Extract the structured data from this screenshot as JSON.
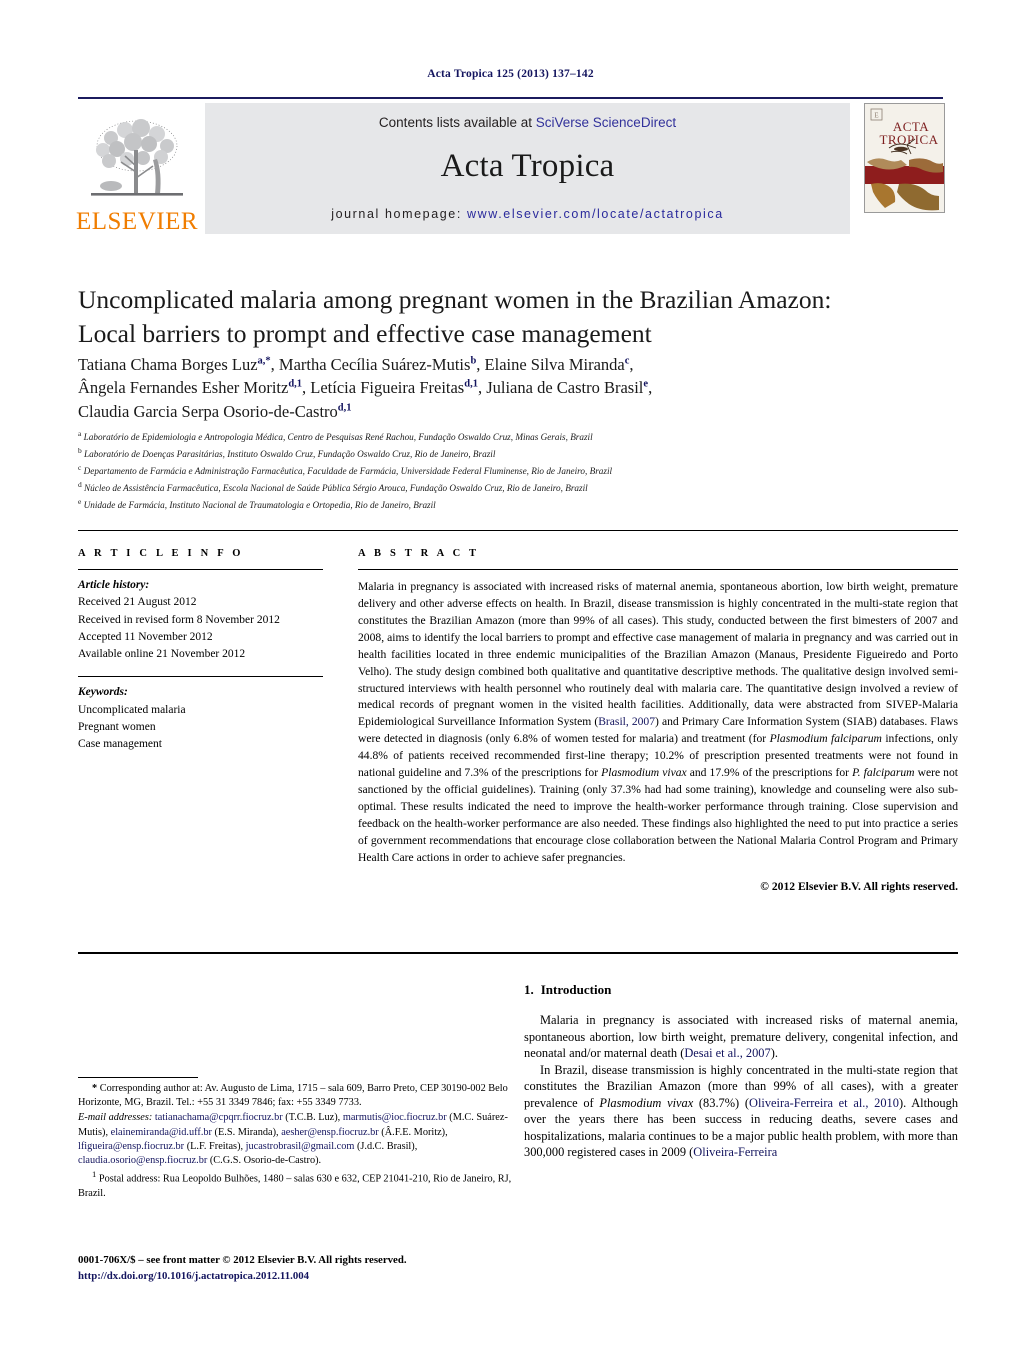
{
  "running_head": "Acta Tropica 125 (2013) 137–142",
  "header": {
    "contents_prefix": "Contents lists available at ",
    "contents_link": "SciVerse ScienceDirect",
    "journal_title": "Acta Tropica",
    "homepage_label": "journal homepage:",
    "homepage_url": "www.elsevier.com/locate/actatropica",
    "publisher_logo_text": "ELSEVIER",
    "cover_title_line1": "ACTA",
    "cover_title_line2": "TROPICA",
    "accent_orange": "#f07d00",
    "accent_navy": "#13145e",
    "link_blue": "#32329b",
    "banner_bg": "#e6e7e9"
  },
  "article": {
    "title_line1": "Uncomplicated malaria among pregnant women in the Brazilian Amazon:",
    "title_line2": "Local barriers to prompt and effective case management",
    "authors_line1": "Tatiana Chama Borges Luz<sup>a,*</sup>, Martha Cecília Suárez-Mutis<sup>b</sup>, Elaine Silva Miranda<sup>c</sup>,",
    "authors_line2": "Ângela Fernandes Esher Moritz<sup>d,1</sup>, Letícia Figueira Freitas<sup>d,1</sup>, Juliana de Castro Brasil<sup>e</sup>,",
    "authors_line3": "Claudia Garcia Serpa Osorio-de-Castro<sup>d,1</sup>",
    "affiliations": [
      {
        "mark": "a",
        "text": "Laboratório de Epidemiologia e Antropologia Médica, Centro de Pesquisas René Rachou, Fundação Oswaldo Cruz, Minas Gerais, Brazil"
      },
      {
        "mark": "b",
        "text": "Laboratório de Doenças Parasitárias, Instituto Oswaldo Cruz, Fundação Oswaldo Cruz, Rio de Janeiro, Brazil"
      },
      {
        "mark": "c",
        "text": "Departamento de Farmácia e Administração Farmacêutica, Faculdade de Farmácia, Universidade Federal Fluminense, Rio de Janeiro, Brazil"
      },
      {
        "mark": "d",
        "text": "Núcleo de Assistência Farmacêutica, Escola Nacional de Saúde Pública Sérgio Arouca, Fundação Oswaldo Cruz, Rio de Janeiro, Brazil"
      },
      {
        "mark": "e",
        "text": "Unidade de Farmácia, Instituto Nacional de Traumatologia e Ortopedia, Rio de Janeiro, Brazil"
      }
    ]
  },
  "article_info": {
    "heading": "A R T I C L E   I N F O",
    "history_label": "Article history:",
    "history": [
      "Received 21 August 2012",
      "Received in revised form 8 November 2012",
      "Accepted 11 November 2012",
      "Available online 21 November 2012"
    ],
    "keywords_label": "Keywords:",
    "keywords": [
      "Uncomplicated malaria",
      "Pregnant women",
      "Case management"
    ]
  },
  "abstract": {
    "heading": "A B S T R A C T",
    "html": "Malaria in pregnancy is associated with increased risks of maternal anemia, spontaneous abortion, low birth weight, premature delivery and other adverse effects on health. In Brazil, disease transmission is highly concentrated in the multi-state region that constitutes the Brazilian Amazon (more than 99% of all cases). This study, conducted between the first bimesters of 2007 and 2008, aims to identify the local barriers to prompt and effective case management of malaria in pregnancy and was carried out in health facilities located in three endemic municipalities of the Brazilian Amazon (Manaus, Presidente Figueiredo and Porto Velho). The study design combined both qualitative and quantitative descriptive methods. The qualitative design involved semi-structured interviews with health personnel who routinely deal with malaria care. The quantitative design involved a review of medical records of pregnant women in the visited health facilities. Additionally, data were abstracted from SIVEP-Malaria Epidemiological Surveillance Information System (<a href=\"#\">Brasil, 2007</a>) and Primary Care Information System (SIAB) databases. Flaws were detected in diagnosis (only 6.8% of women tested for malaria) and treatment (for <i>Plasmodium falciparum</i> infections, only 44.8% of patients received recommended first-line therapy; 10.2% of prescription presented treatments were not found in national guideline and 7.3% of the prescriptions for <i>Plasmodium vivax</i> and 17.9% of the prescriptions for <i>P. falciparum</i> were not sanctioned by the official guidelines). Training (only 37.3% had had some training), knowledge and counseling were also sub-optimal. These results indicated the need to improve the health-worker performance through training. Close supervision and feedback on the health-worker performance are also needed. These findings also highlighted the need to put into practice a series of government recommendations that encourage close collaboration between the National Malaria Control Program and Primary Health Care actions in order to achieve safer pregnancies.",
    "copyright": "© 2012 Elsevier B.V. All rights reserved."
  },
  "introduction": {
    "number": "1.",
    "heading": "Introduction",
    "paragraph1": "Malaria in pregnancy is associated with increased risks of maternal anemia, spontaneous abortion, low birth weight, premature delivery, congenital infection, and neonatal and/or maternal death (<a href=\"#\">Desai et al., 2007</a>).",
    "paragraph2": "In Brazil, disease transmission is highly concentrated in the multi-state region that constitutes the Brazilian Amazon (more than 99% of all cases), with a greater prevalence of <i>Plasmodium vivax</i> (83.7%) (<a href=\"#\">Oliveira-Ferreira et al., 2010</a>). Although over the years there has been success in reducing deaths, severe cases and hospitalizations, malaria continues to be a major public health problem, with more than 300,000 registered cases in 2009 (<a href=\"#\">Oliveira-Ferreira</a>"
  },
  "footnotes": {
    "corresponding_html": "<b>*</b> Corresponding author at: Av. Augusto de Lima, 1715 – sala 609, Barro Preto, CEP 30190-002 Belo Horizonte, MG, Brazil. Tel.: +55 31 3349 7846; fax: +55 3349 7733.",
    "email_label": "E-mail addresses:",
    "email_html": "<a href=\"#\">tatianachama@cpqrr.fiocruz.br</a> (T.C.B. Luz), <a href=\"#\">marmutis@ioc.fiocruz.br</a> (M.C. Suárez-Mutis), <a href=\"#\">elainemiranda@id.uff.br</a> (E.S. Miranda), <a href=\"#\">aesher@ensp.fiocruz.br</a> (Â.F.E. Moritz), <a href=\"#\">lfigueira@ensp.fiocruz.br</a> (L.F. Freitas), <a href=\"#\">jucastrobrasil@gmail.com</a> (J.d.C. Brasil), <a href=\"#\">claudia.osorio@ensp.fiocruz.br</a> (C.G.S. Osorio-de-Castro).",
    "postal_html": "<sup>1</sup> Postal address: Rua Leopoldo Bulhões, 1480 – salas 630 e 632, CEP 21041-210, Rio de Janeiro, RJ, Brazil."
  },
  "footer": {
    "issn_line": "0001-706X/$ – see front matter © 2012 Elsevier B.V. All rights reserved.",
    "doi": "http://dx.doi.org/10.1016/j.actatropica.2012.11.004"
  }
}
